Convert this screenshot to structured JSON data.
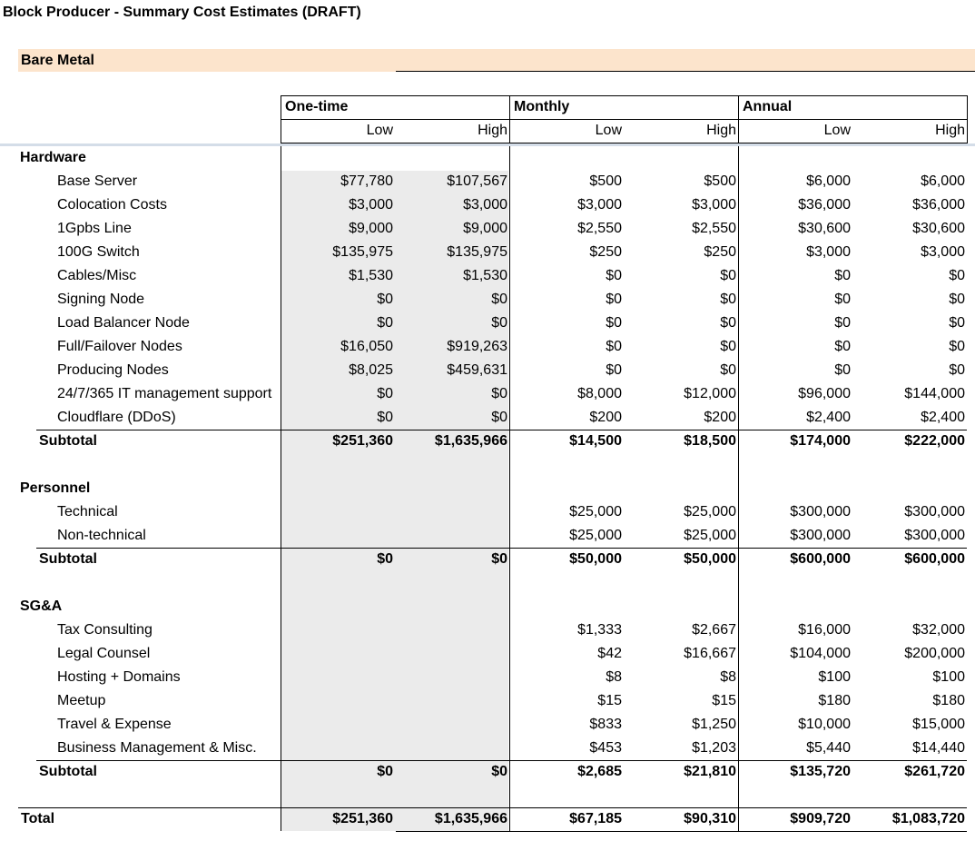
{
  "title": "Block Producer - Summary Cost Estimates (DRAFT)",
  "section_band": "Bare Metal",
  "periods": [
    "One-time",
    "Monthly",
    "Annual"
  ],
  "sub_headers": [
    "Low",
    "High",
    "Low",
    "High",
    "Low",
    "High"
  ],
  "groups": [
    {
      "name": "Hardware",
      "rows": [
        {
          "label": "Base Server",
          "values": [
            "$77,780",
            "$107,567",
            "$500",
            "$500",
            "$6,000",
            "$6,000"
          ]
        },
        {
          "label": "Colocation Costs",
          "values": [
            "$3,000",
            "$3,000",
            "$3,000",
            "$3,000",
            "$36,000",
            "$36,000"
          ]
        },
        {
          "label": "1Gpbs Line",
          "values": [
            "$9,000",
            "$9,000",
            "$2,550",
            "$2,550",
            "$30,600",
            "$30,600"
          ]
        },
        {
          "label": "100G Switch",
          "values": [
            "$135,975",
            "$135,975",
            "$250",
            "$250",
            "$3,000",
            "$3,000"
          ]
        },
        {
          "label": "Cables/Misc",
          "values": [
            "$1,530",
            "$1,530",
            "$0",
            "$0",
            "$0",
            "$0"
          ]
        },
        {
          "label": "Signing Node",
          "values": [
            "$0",
            "$0",
            "$0",
            "$0",
            "$0",
            "$0"
          ]
        },
        {
          "label": "Load Balancer Node",
          "values": [
            "$0",
            "$0",
            "$0",
            "$0",
            "$0",
            "$0"
          ]
        },
        {
          "label": "Full/Failover Nodes",
          "values": [
            "$16,050",
            "$919,263",
            "$0",
            "$0",
            "$0",
            "$0"
          ]
        },
        {
          "label": "Producing Nodes",
          "values": [
            "$8,025",
            "$459,631",
            "$0",
            "$0",
            "$0",
            "$0"
          ]
        },
        {
          "label": "24/7/365 IT management support",
          "values": [
            "$0",
            "$0",
            "$8,000",
            "$12,000",
            "$96,000",
            "$144,000"
          ]
        },
        {
          "label": "Cloudflare (DDoS)",
          "values": [
            "$0",
            "$0",
            "$200",
            "$200",
            "$2,400",
            "$2,400"
          ]
        }
      ],
      "subtotal_label": "Subtotal",
      "subtotal": [
        "$251,360",
        "$1,635,966",
        "$14,500",
        "$18,500",
        "$174,000",
        "$222,000"
      ]
    },
    {
      "name": "Personnel",
      "rows": [
        {
          "label": "Technical",
          "values": [
            "",
            "",
            "$25,000",
            "$25,000",
            "$300,000",
            "$300,000"
          ]
        },
        {
          "label": "Non-technical",
          "values": [
            "",
            "",
            "$25,000",
            "$25,000",
            "$300,000",
            "$300,000"
          ]
        }
      ],
      "subtotal_label": "Subtotal",
      "subtotal": [
        "$0",
        "$0",
        "$50,000",
        "$50,000",
        "$600,000",
        "$600,000"
      ]
    },
    {
      "name": "SG&A",
      "rows": [
        {
          "label": "Tax Consulting",
          "values": [
            "",
            "",
            "$1,333",
            "$2,667",
            "$16,000",
            "$32,000"
          ]
        },
        {
          "label": "Legal Counsel",
          "values": [
            "",
            "",
            "$42",
            "$16,667",
            "$104,000",
            "$200,000"
          ]
        },
        {
          "label": "Hosting + Domains",
          "values": [
            "",
            "",
            "$8",
            "$8",
            "$100",
            "$100"
          ]
        },
        {
          "label": "Meetup",
          "values": [
            "",
            "",
            "$15",
            "$15",
            "$180",
            "$180"
          ]
        },
        {
          "label": "Travel & Expense",
          "values": [
            "",
            "",
            "$833",
            "$1,250",
            "$10,000",
            "$15,000"
          ]
        },
        {
          "label": "Business Management & Misc.",
          "values": [
            "",
            "",
            "$453",
            "$1,203",
            "$5,440",
            "$14,440"
          ]
        }
      ],
      "subtotal_label": "Subtotal",
      "subtotal": [
        "$0",
        "$0",
        "$2,685",
        "$21,810",
        "$135,720",
        "$261,720"
      ]
    }
  ],
  "total_label": "Total",
  "total": [
    "$251,360",
    "$1,635,966",
    "$67,185",
    "$90,310",
    "$909,720",
    "$1,083,720"
  ]
}
